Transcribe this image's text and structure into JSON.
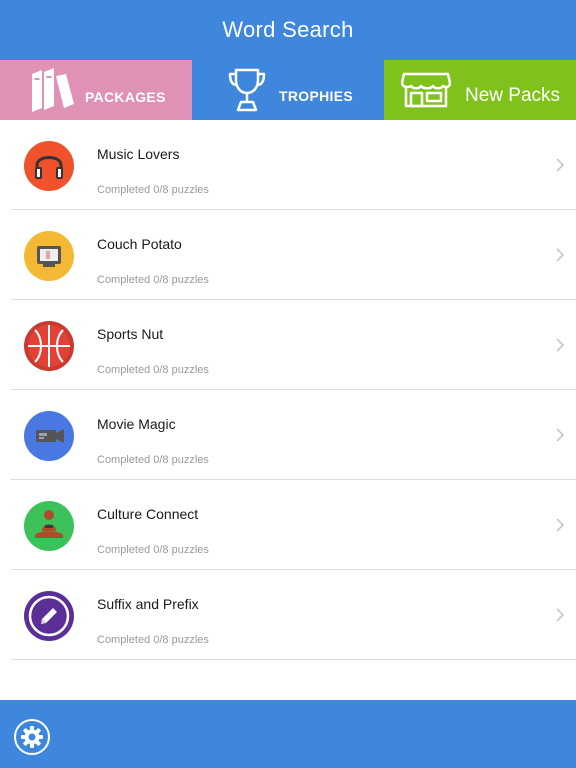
{
  "header": {
    "title": "Word Search"
  },
  "tabs": [
    {
      "label": "PACKAGES",
      "color": "#df92b6",
      "icon": "books-icon"
    },
    {
      "label": "TROPHIES",
      "color": "#3f86dd",
      "icon": "trophy-icon"
    },
    {
      "label": "New Packs",
      "color": "#7fc21c",
      "icon": "store-icon"
    }
  ],
  "packages": [
    {
      "title": "Music Lovers",
      "subtitle": "Completed 0/8 puzzles",
      "color": "#f0522b",
      "icon": "headphones-icon"
    },
    {
      "title": "Couch Potato",
      "subtitle": "Completed 0/8 puzzles",
      "color": "#f3b834",
      "icon": "tv-icon"
    },
    {
      "title": "Sports Nut",
      "subtitle": "Completed 0/8 puzzles",
      "color": "#e24236",
      "icon": "basketball-icon"
    },
    {
      "title": "Movie Magic",
      "subtitle": "Completed 0/8 puzzles",
      "color": "#4a78e3",
      "icon": "camera-icon"
    },
    {
      "title": "Culture Connect",
      "subtitle": "Completed 0/8 puzzles",
      "color": "#3dc25b",
      "icon": "meditation-icon"
    },
    {
      "title": "Suffix and Prefix",
      "subtitle": "Completed 0/8 puzzles",
      "color": "#5c2f96",
      "icon": "pencil-icon"
    }
  ],
  "footer": {
    "icon": "gear-icon",
    "color": "#3f86dd"
  }
}
